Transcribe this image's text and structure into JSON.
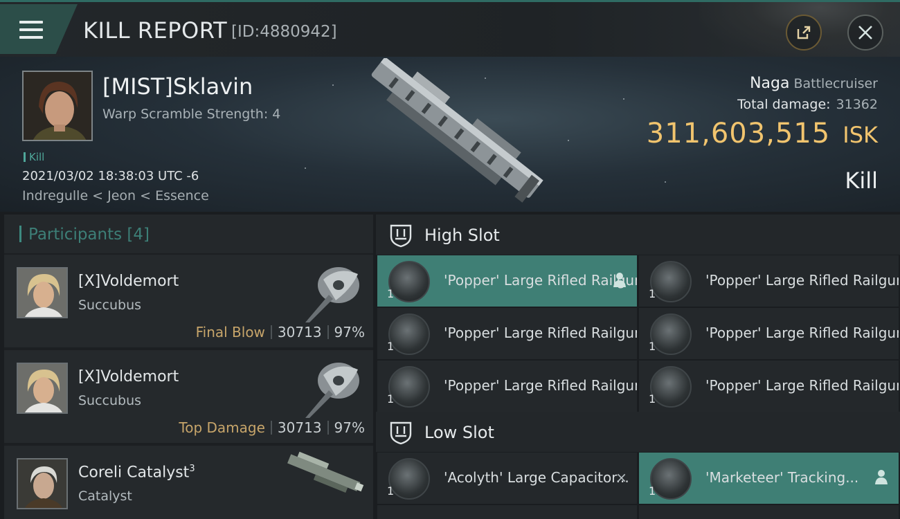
{
  "header": {
    "title": "KILL REPORT",
    "report_id": "[ID:4880942]"
  },
  "victim": {
    "name": "[MIST]Sklavin",
    "warp_scramble": "Warp Scramble Strength: 4",
    "tag": "Kill",
    "datetime": "2021/03/02 18:38:03 UTC -6",
    "location": "Indregulle < Jeon < Essence"
  },
  "ship": {
    "name": "Naga",
    "class": "Battlecruiser",
    "total_damage_label": "Total damage:",
    "total_damage_value": "31362",
    "isk_value": "311,603,515",
    "isk_unit": "ISK",
    "result": "Kill"
  },
  "participants": {
    "header": "Participants [4]",
    "items": [
      {
        "name": "[X]Voldemort",
        "ship": "Succubus",
        "role": "Final Blow",
        "damage": "30713",
        "percent": "97%"
      },
      {
        "name": "[X]Voldemort",
        "ship": "Succubus",
        "role": "Top Damage",
        "damage": "30713",
        "percent": "97%"
      },
      {
        "name": "Coreli Catalyst",
        "name_sup": "3",
        "ship": "Catalyst"
      }
    ]
  },
  "slots": {
    "high_label": "High Slot",
    "low_label": "Low Slot",
    "high_items": [
      {
        "name": "'Popper' Large Rifled Railgun",
        "qty": "1",
        "active": true
      },
      {
        "name": "'Popper' Large Rifled Railgun",
        "qty": "1"
      },
      {
        "name": "'Popper' Large Rifled Railgun",
        "qty": "1"
      },
      {
        "name": "'Popper' Large Rifled Railgun",
        "qty": "1"
      },
      {
        "name": "'Popper' Large Rifled Railgun",
        "qty": "1"
      },
      {
        "name": "'Popper' Large Rifled Railgun",
        "qty": "1"
      }
    ],
    "low_items": [
      {
        "name": "'Acolyth' Large Capacitor...",
        "qty": "1",
        "mark": "×"
      },
      {
        "name": "'Marketeer' Tracking...",
        "qty": "1",
        "active": true
      }
    ]
  },
  "colors": {
    "accent_teal": "#3f7f75",
    "isk_gold": "#f1c46e",
    "role_gold": "#c7a56a"
  },
  "icons": {
    "menu": "hamburger-menu-icon",
    "share": "share-export-icon",
    "close": "close-icon",
    "slot": "shield-slot-icon",
    "person": "person-icon"
  }
}
